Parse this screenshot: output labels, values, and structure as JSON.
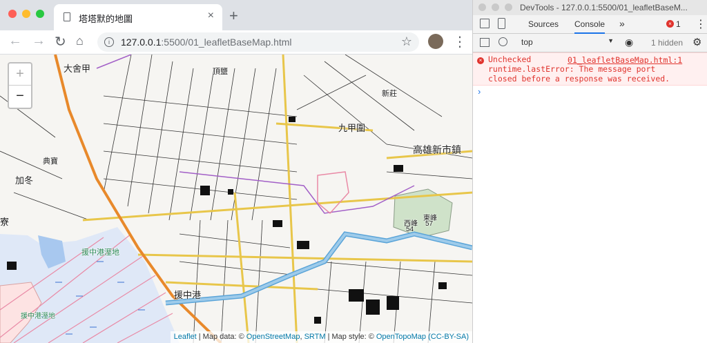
{
  "browser": {
    "tab_title": "塔塔默的地圖",
    "tab_close": "×",
    "new_tab": "+",
    "url_host": "127.0.0.1",
    "url_rest": ":5500/01_leafletBaseMap.html"
  },
  "map": {
    "zoom_in": "+",
    "zoom_out": "−",
    "place_labels": [
      "大舍甲",
      "頂鹽",
      "新莊",
      "九甲圍",
      "高雄新市鎮",
      "典寶",
      "加冬",
      "寮",
      "援中港溼地",
      "援中港",
      "東峰",
      "57",
      "西峰",
      "54",
      "援中港溼地"
    ],
    "attribution": {
      "leaflet": "Leaflet",
      "sep1": " | Map data: © ",
      "osm": "OpenStreetMap",
      "comma": ", ",
      "srtm": "SRTM",
      "sep2": " | Map style: © ",
      "otm": "OpenTopoMap",
      "license": "(CC-BY-SA)"
    }
  },
  "devtools": {
    "title": "DevTools - 127.0.0.1:5500/01_leafletBaseM...",
    "tabs": [
      "Sources",
      "Console"
    ],
    "more": "»",
    "error_count": "1",
    "context": "top",
    "hidden": "1 hidden",
    "error": {
      "line1": "Unchecked",
      "link": "01_leafletBaseMap.html:1",
      "line2": "runtime.lastError: The message port",
      "line3": "closed before a response was received."
    },
    "prompt": "›"
  }
}
